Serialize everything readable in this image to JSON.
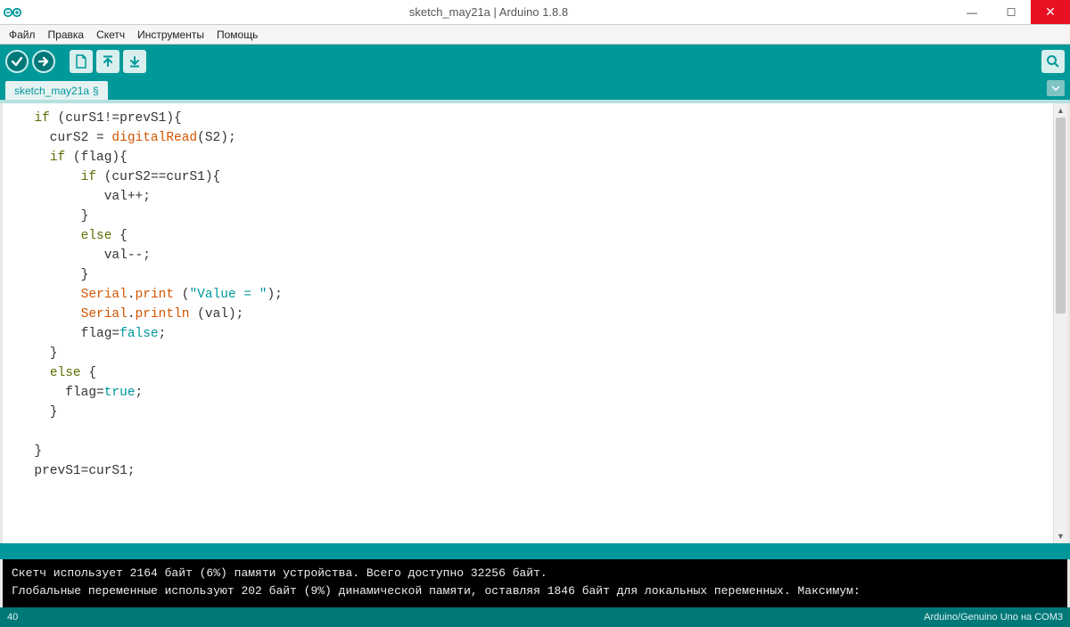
{
  "window": {
    "title": "sketch_may21a | Arduino 1.8.8"
  },
  "menu": {
    "file": "Файл",
    "edit": "Правка",
    "sketch": "Скетч",
    "tools": "Инструменты",
    "help": "Помощь"
  },
  "tab": {
    "name": "sketch_may21a",
    "mod": "§"
  },
  "icons": {
    "verify_tooltip": "Verify",
    "upload_tooltip": "Upload",
    "new_tooltip": "New",
    "open_tooltip": "Open",
    "save_tooltip": "Save",
    "serial_tooltip": "Serial Monitor"
  },
  "code": {
    "l1a": "  ",
    "l1_kw": "if",
    "l1b": " (curS1!=prevS1){",
    "l2a": "    curS2 = ",
    "l2_fn": "digitalRead",
    "l2b": "(S2);",
    "l3a": "    ",
    "l3_kw": "if",
    "l3b": " (flag){",
    "l4a": "        ",
    "l4_kw": "if",
    "l4b": " (curS2==curS1){",
    "l5": "           val++;",
    "l6": "        }",
    "l7a": "        ",
    "l7_kw": "else",
    "l7b": " {",
    "l8": "           val--;",
    "l9": "        }",
    "l10a": "        ",
    "l10_s": "Serial",
    "l10b": ".",
    "l10_m": "print",
    "l10c": " (",
    "l10_str": "\"Value = \"",
    "l10d": ");",
    "l11a": "        ",
    "l11_s": "Serial",
    "l11b": ".",
    "l11_m": "println",
    "l11c": " (val);",
    "l12a": "        flag=",
    "l12_v": "false",
    "l12b": ";",
    "l13": "    }",
    "l14a": "    ",
    "l14_kw": "else",
    "l14b": " {",
    "l15a": "      flag=",
    "l15_v": "true",
    "l15b": ";",
    "l16": "    }",
    "l17": "    ",
    "l18": "  }",
    "l19": "  prevS1=curS1;"
  },
  "console": {
    "line1": "Скетч использует 2164 байт (6%) памяти устройства. Всего доступно 32256 байт.",
    "line2": "Глобальные переменные используют 202 байт (9%) динамической памяти, оставляя 1846 байт для локальных переменных. Максимум:"
  },
  "footer": {
    "line": "40",
    "board": "Arduino/Genuino Uno на COM3"
  }
}
